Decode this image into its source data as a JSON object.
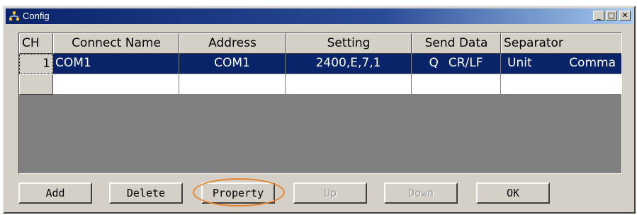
{
  "window": {
    "title": "Config",
    "app_icon": "network-icon",
    "controls": {
      "minimize": "_",
      "maximize": "□",
      "close": "✕"
    }
  },
  "grid": {
    "columns": [
      "CH",
      "Connect Name",
      "Address",
      "Setting",
      "Send Data",
      "Separator"
    ],
    "rows": [
      {
        "ch": "1",
        "name": "COM1",
        "address": "COM1",
        "setting": "2400,E,7,1",
        "send_a": "Q",
        "send_b": "CR/LF",
        "sep_a": "Unit",
        "sep_b": "Comma",
        "selected": true
      },
      {
        "ch": "",
        "name": "",
        "address": "",
        "setting": "",
        "send_a": "",
        "send_b": "",
        "sep_a": "",
        "sep_b": "",
        "selected": false
      }
    ]
  },
  "buttons": {
    "add": "Add",
    "delete": "Delete",
    "property": "Property",
    "up": "Up",
    "down": "Down",
    "ok": "OK"
  },
  "colors": {
    "face": "#d4d0c8",
    "selection": "#0a246a",
    "grid_empty": "#808080",
    "highlight": "#e8842c"
  }
}
